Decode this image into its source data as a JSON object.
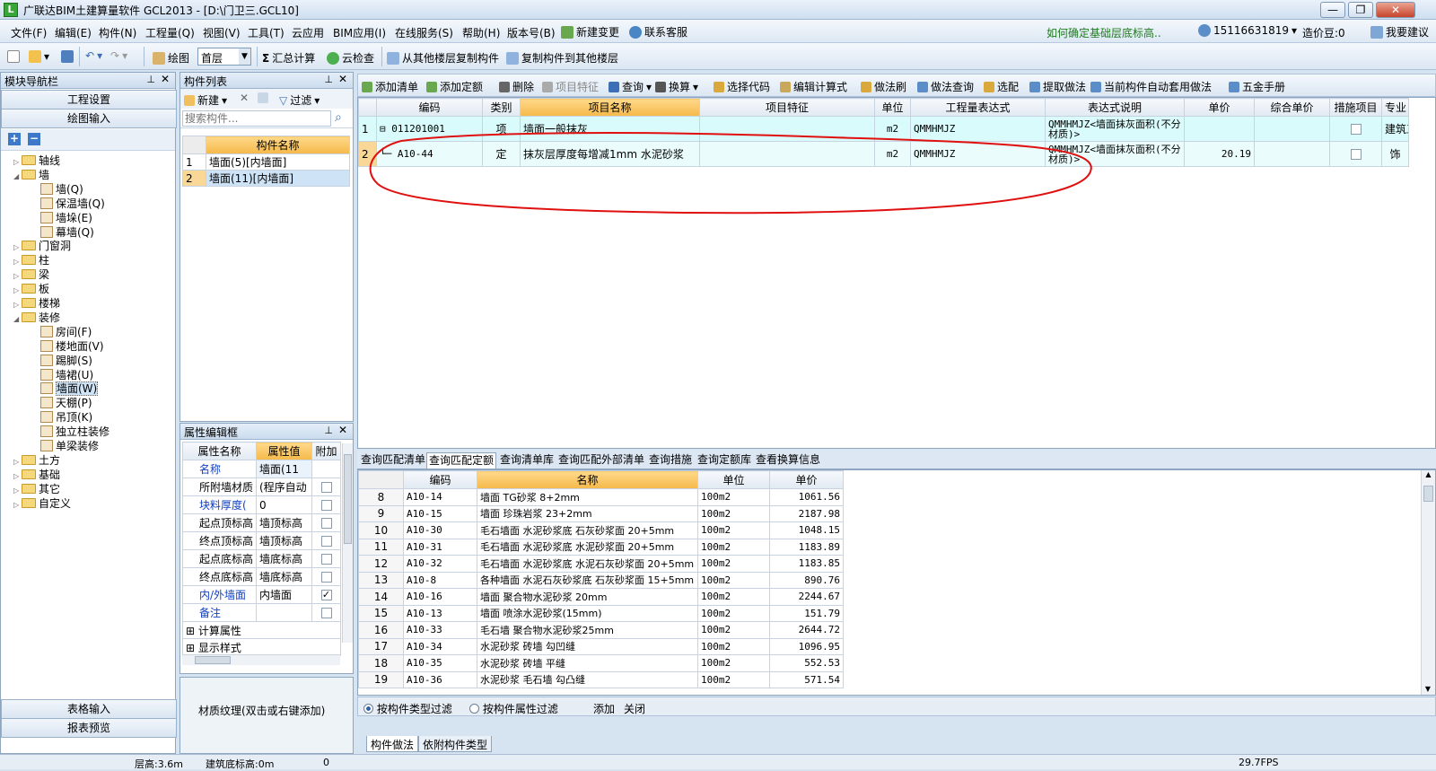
{
  "window": {
    "title": "广联达BIM土建算量软件 GCL2013 - [D:\\门卫三.GCL10]",
    "icon_text": "L",
    "min": "—",
    "restore": "❐",
    "close": "✕"
  },
  "menu": [
    "文件(F)",
    "编辑(E)",
    "构件(N)",
    "工程量(Q)",
    "视图(V)",
    "工具(T)",
    "云应用",
    "BIM应用(I)",
    "在线服务(S)",
    "帮助(H)",
    "版本号(B)",
    "新建变更",
    "联系客服"
  ],
  "menu_right": {
    "hint": "如何确定基础层底标高..",
    "phone": "15116631819",
    "price_bean": "造价豆:0",
    "suggest": "我要建议"
  },
  "toolbar": {
    "draw": "绘图",
    "floor": "首层",
    "sum": "汇总计算",
    "cloud_check": "云检查",
    "copy_from": "从其他楼层复制构件",
    "copy_to": "复制构件到其他楼层"
  },
  "nav": {
    "title": "模块导航栏",
    "top_buttons": [
      "工程设置",
      "绘图输入"
    ],
    "tree": [
      {
        "label": "轴线",
        "level": 0,
        "exp": "▷",
        "icon": "folder"
      },
      {
        "label": "墙",
        "level": 0,
        "exp": "◢",
        "icon": "folder"
      },
      {
        "label": "墙(Q)",
        "level": 1,
        "icon": "leaf"
      },
      {
        "label": "保温墙(Q)",
        "level": 1,
        "icon": "leaf"
      },
      {
        "label": "墙垛(E)",
        "level": 1,
        "icon": "leaf"
      },
      {
        "label": "幕墙(Q)",
        "level": 1,
        "icon": "leaf"
      },
      {
        "label": "门窗洞",
        "level": 0,
        "exp": "▷",
        "icon": "folder"
      },
      {
        "label": "柱",
        "level": 0,
        "exp": "▷",
        "icon": "folder"
      },
      {
        "label": "梁",
        "level": 0,
        "exp": "▷",
        "icon": "folder"
      },
      {
        "label": "板",
        "level": 0,
        "exp": "▷",
        "icon": "folder"
      },
      {
        "label": "楼梯",
        "level": 0,
        "exp": "▷",
        "icon": "folder"
      },
      {
        "label": "装修",
        "level": 0,
        "exp": "◢",
        "icon": "folder"
      },
      {
        "label": "房间(F)",
        "level": 1,
        "icon": "leaf"
      },
      {
        "label": "楼地面(V)",
        "level": 1,
        "icon": "leaf"
      },
      {
        "label": "踢脚(S)",
        "level": 1,
        "icon": "leaf"
      },
      {
        "label": "墙裙(U)",
        "level": 1,
        "icon": "leaf"
      },
      {
        "label": "墙面(W)",
        "level": 1,
        "icon": "leaf",
        "selected": true
      },
      {
        "label": "天棚(P)",
        "level": 1,
        "icon": "leaf"
      },
      {
        "label": "吊顶(K)",
        "level": 1,
        "icon": "leaf"
      },
      {
        "label": "独立柱装修",
        "level": 1,
        "icon": "leaf"
      },
      {
        "label": "单梁装修",
        "level": 1,
        "icon": "leaf"
      },
      {
        "label": "土方",
        "level": 0,
        "exp": "▷",
        "icon": "folder"
      },
      {
        "label": "基础",
        "level": 0,
        "exp": "▷",
        "icon": "folder"
      },
      {
        "label": "其它",
        "level": 0,
        "exp": "▷",
        "icon": "folder"
      },
      {
        "label": "自定义",
        "level": 0,
        "exp": "▷",
        "icon": "folder"
      }
    ],
    "bottom_buttons": [
      "表格输入",
      "报表预览"
    ]
  },
  "component_list": {
    "title": "构件列表",
    "new": "新建",
    "filter": "过滤",
    "search_placeholder": "搜索构件...",
    "header": "构件名称",
    "rows": [
      {
        "no": "1",
        "name": "墙面(5)[内墙面]"
      },
      {
        "no": "2",
        "name": "墙面(11)[内墙面]"
      }
    ]
  },
  "props": {
    "title": "属性编辑框",
    "headers": [
      "属性名称",
      "属性值",
      "附加"
    ],
    "rows": [
      {
        "name": "名称",
        "value": "墙面(11",
        "blue": true,
        "chk": null
      },
      {
        "name": "所附墙材质",
        "value": "(程序自动",
        "blue": false,
        "chk": false
      },
      {
        "name": "块料厚度(",
        "value": "0",
        "blue": true,
        "chk": false
      },
      {
        "name": "起点顶标高",
        "value": "墙顶标高",
        "blue": false,
        "chk": false
      },
      {
        "name": "终点顶标高",
        "value": "墙顶标高",
        "blue": false,
        "chk": false
      },
      {
        "name": "起点底标高",
        "value": "墙底标高",
        "blue": false,
        "chk": false
      },
      {
        "name": "终点底标高",
        "value": "墙底标高",
        "blue": false,
        "chk": false
      },
      {
        "name": "内/外墙面",
        "value": "内墙面",
        "blue": true,
        "chk": true
      },
      {
        "name": "备注",
        "value": "",
        "blue": true,
        "chk": false
      }
    ],
    "groups": [
      "计算属性",
      "显示样式"
    ],
    "texture": "材质纹理(双击或右键添加)"
  },
  "main_toolbar": [
    "添加清单",
    "添加定额",
    "删除",
    "项目特征",
    "查询",
    "换算",
    "选择代码",
    "编辑计算式",
    "做法刷",
    "做法查询",
    "选配",
    "提取做法",
    "当前构件自动套用做法",
    "五金手册"
  ],
  "main_table": {
    "headers": [
      "编码",
      "类别",
      "项目名称",
      "项目特征",
      "单位",
      "工程量表达式",
      "表达式说明",
      "单价",
      "综合单价",
      "措施项目",
      "专业"
    ],
    "rows": [
      {
        "no": "1",
        "code": "011201001",
        "type": "项",
        "name": "墙面一般抹灰",
        "feature": "",
        "unit": "m2",
        "expr": "QMMHMJZ",
        "desc": "QMMHMJZ<墙面抹灰面积(不分材质)>",
        "price": "",
        "total": "",
        "spec": "建筑工程"
      },
      {
        "no": "2",
        "code": "A10-44",
        "type": "定",
        "name": "抹灰层厚度每增减1mm 水泥砂浆",
        "feature": "",
        "unit": "m2",
        "expr": "QMMHMJZ",
        "desc": "QMMHMJZ<墙面抹灰面积(不分材质)>",
        "price": "20.19",
        "total": "",
        "spec": "饰"
      }
    ]
  },
  "lower_tabs": [
    "查询匹配清单",
    "查询匹配定额",
    "查询清单库",
    "查询匹配外部清单",
    "查询措施",
    "查询定额库",
    "查看换算信息"
  ],
  "quota_table": {
    "headers": [
      "编码",
      "名称",
      "单位",
      "单价"
    ],
    "rows": [
      [
        "8",
        "A10-14",
        "墙面 TG砂浆 8+2mm",
        "100m2",
        "1061.56"
      ],
      [
        "9",
        "A10-15",
        "墙面 珍珠岩浆 23+2mm",
        "100m2",
        "2187.98"
      ],
      [
        "10",
        "A10-30",
        "毛石墙面 水泥砂浆底 石灰砂浆面 20+5mm",
        "100m2",
        "1048.15"
      ],
      [
        "11",
        "A10-31",
        "毛石墙面 水泥砂浆底 水泥砂浆面 20+5mm",
        "100m2",
        "1183.89"
      ],
      [
        "12",
        "A10-32",
        "毛石墙面 水泥砂浆底 水泥石灰砂浆面 20+5mm",
        "100m2",
        "1183.85"
      ],
      [
        "13",
        "A10-8",
        "各种墙面 水泥石灰砂浆底 石灰砂浆面 15+5mm",
        "100m2",
        "890.76"
      ],
      [
        "14",
        "A10-16",
        "墙面 聚合物水泥砂浆 20mm",
        "100m2",
        "2244.67"
      ],
      [
        "15",
        "A10-13",
        "墙面 喷涂水泥砂浆(15mm)",
        "100m2",
        "151.79"
      ],
      [
        "16",
        "A10-33",
        "毛石墙 聚合物水泥砂浆25mm",
        "100m2",
        "2644.72"
      ],
      [
        "17",
        "A10-34",
        "水泥砂浆 砖墙 勾凹缝",
        "100m2",
        "1096.95"
      ],
      [
        "18",
        "A10-35",
        "水泥砂浆 砖墙 平缝",
        "100m2",
        "552.53"
      ],
      [
        "19",
        "A10-36",
        "水泥砂浆 毛石墙 勾凸缝",
        "100m2",
        "571.54"
      ]
    ]
  },
  "filter_bar": {
    "opt1": "按构件类型过滤",
    "opt2": "按构件属性过滤",
    "add": "添加",
    "close": "关闭"
  },
  "bottom_tabs": [
    "构件做法",
    "依附构件类型"
  ],
  "status": {
    "floor_height": "层高:3.6m",
    "base_elev": "建筑底标高:0m",
    "zero": "0",
    "fps": "29.7FPS"
  }
}
